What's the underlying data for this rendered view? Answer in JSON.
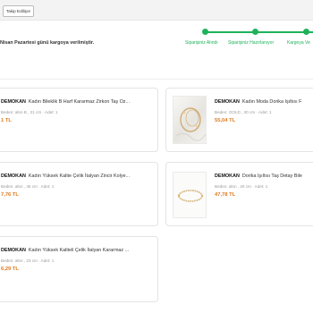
{
  "header": {
    "follow_button": "Takip Edilişor"
  },
  "shipping_note": "Nisan Pazartesi günü kargoya verilmiştir.",
  "progress": {
    "steps": [
      {
        "label": "Siparişiniz Alındı"
      },
      {
        "label": "Siparişiniz Hazırlanıyor"
      },
      {
        "label": "Kargoya Ve"
      }
    ],
    "accent_color": "#1fb25a"
  },
  "products": [
    {
      "brand": "DEMOKAN",
      "name": "Kadın Bileklik B Harf Kararmaz Zirkon Taş Oz...",
      "meta": "Beden: altın B , 21 cm · Adet: 1",
      "price": "1 TL"
    },
    {
      "brand": "DEMOKAN",
      "name": "Kadın Moda Dorika Işıltısı F",
      "meta": "Beden: GOLD , 30 cm · Adet: 1",
      "price": "55,04 TL"
    },
    {
      "brand": "DEMOKAN",
      "name": "Kadın Yüksek Kalite Çelik İtalyan Zincir Kolye...",
      "meta": "Beden: altın , 45 cm · Adet: 1",
      "price": "7,76 TL"
    },
    {
      "brand": "DEMOKAN",
      "name": "Dorika Işıltısı Taş Detay Bile",
      "meta": "Beden: altın , 20 cm · Adet: 1",
      "price": "47,78 TL"
    },
    {
      "brand": "DEMOKAN",
      "name": "Kadın Yüksek Kaliteli Çelik İtalyan Kararmaz ...",
      "meta": "Beden: altın , 23 cm · Adet: 1",
      "price": "6,29 TL"
    }
  ],
  "colors": {
    "price": "#e07a1f",
    "success": "#1fb25a"
  }
}
